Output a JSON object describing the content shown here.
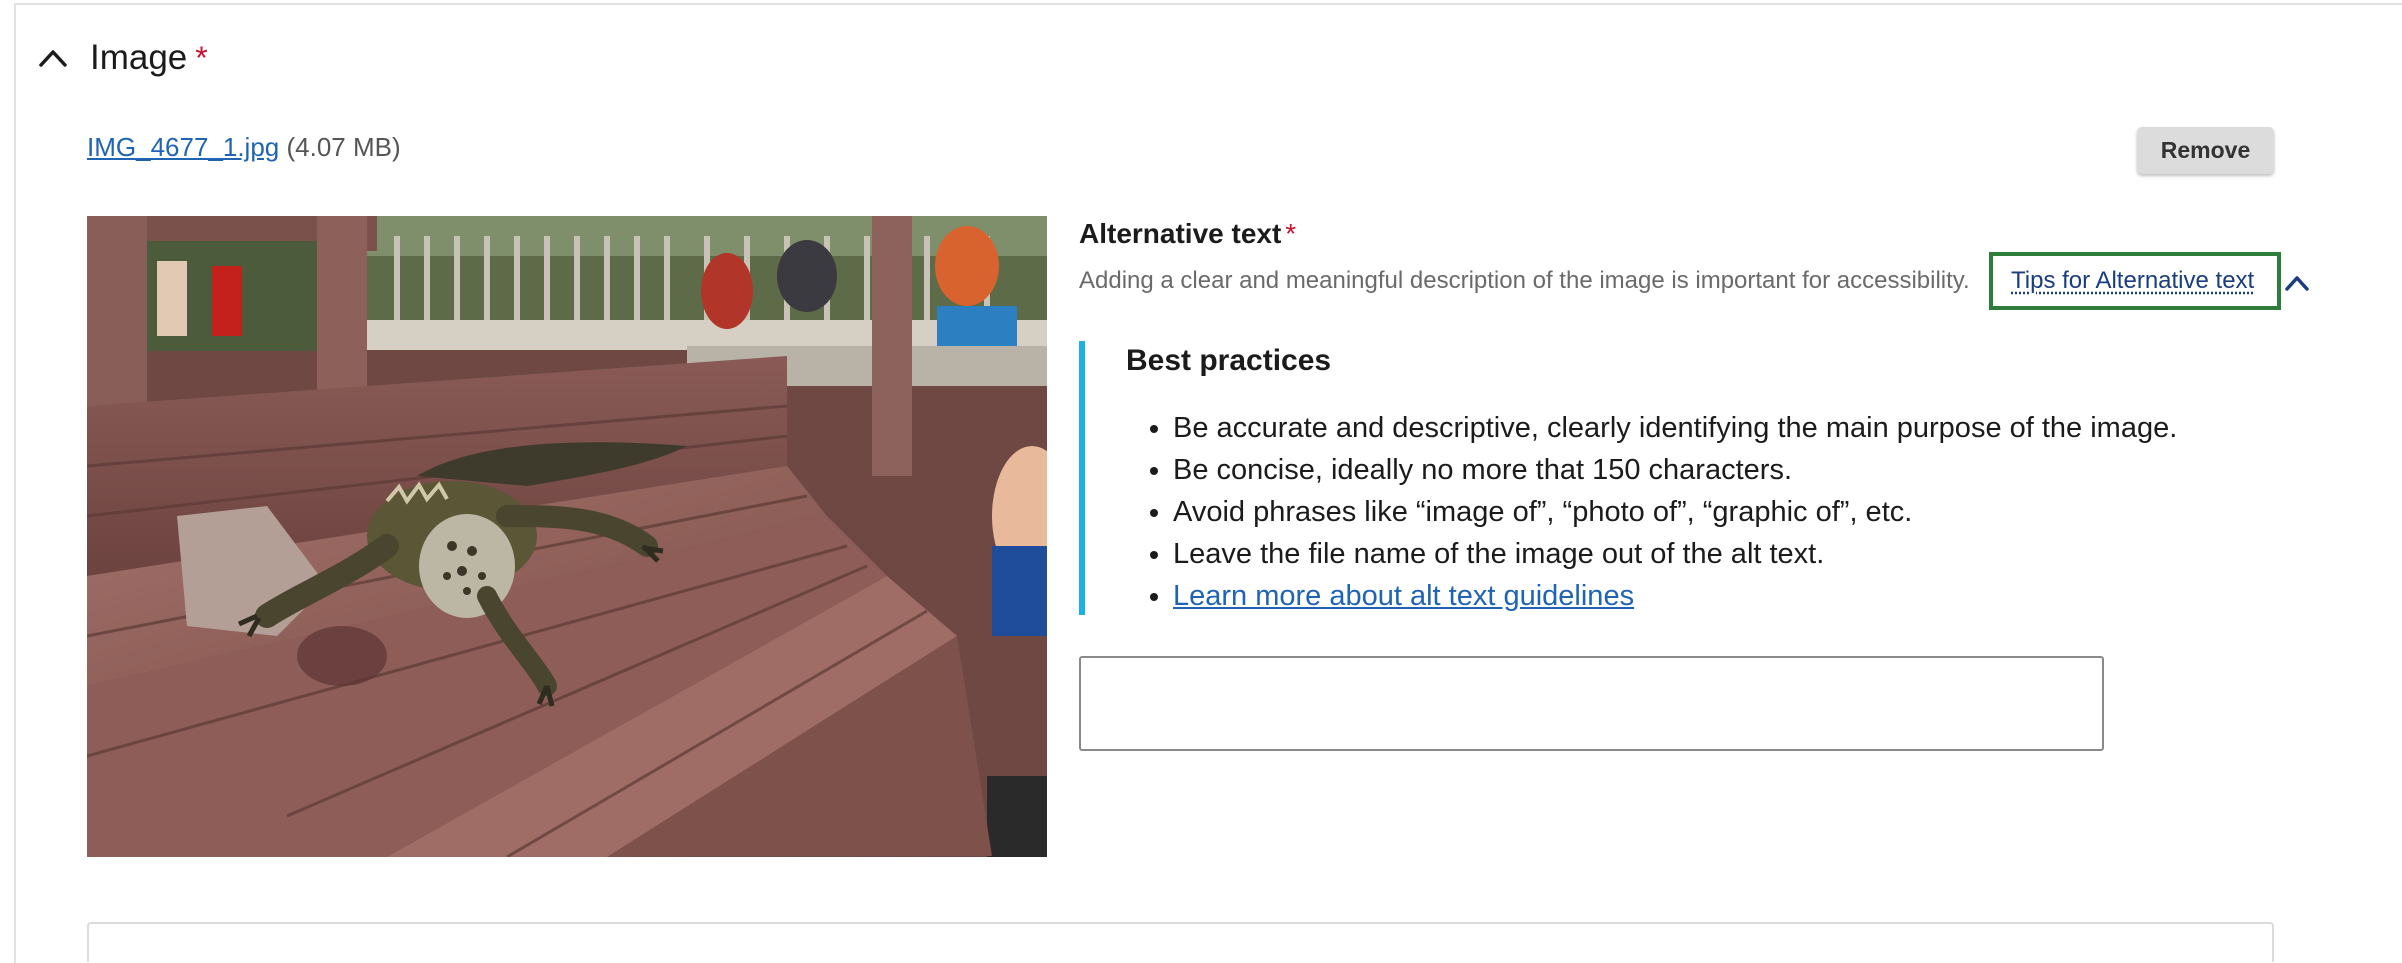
{
  "section": {
    "title": "Image",
    "required_marker": "*"
  },
  "file": {
    "name": "IMG_4677_1.jpg",
    "size": "(4.07 MB)"
  },
  "remove_button": "Remove",
  "alt_text": {
    "label": "Alternative text",
    "required_marker": "*",
    "description": "Adding a clear and meaningful description of the image is important for accessibility.",
    "tips_link": "Tips for Alternative text",
    "value": ""
  },
  "best_practices": {
    "title": "Best practices",
    "items": [
      "Be accurate and descriptive, clearly identifying the main purpose of the image.",
      "Be concise, ideally no more that 150 characters.",
      "Avoid phrases like “image of”, “photo of”, “graphic of”, etc.",
      "Leave the file name of the image out of the alt text."
    ],
    "learn_more": "Learn more about alt text guidelines"
  },
  "colors": {
    "link": "#1f63b3",
    "required": "#c8102e",
    "callout_border": "#1db0e6",
    "focus_outline": "#2e7d3a"
  },
  "icons": {
    "section_toggle": "chevron-up-icon",
    "tips_toggle": "chevron-up-icon"
  }
}
